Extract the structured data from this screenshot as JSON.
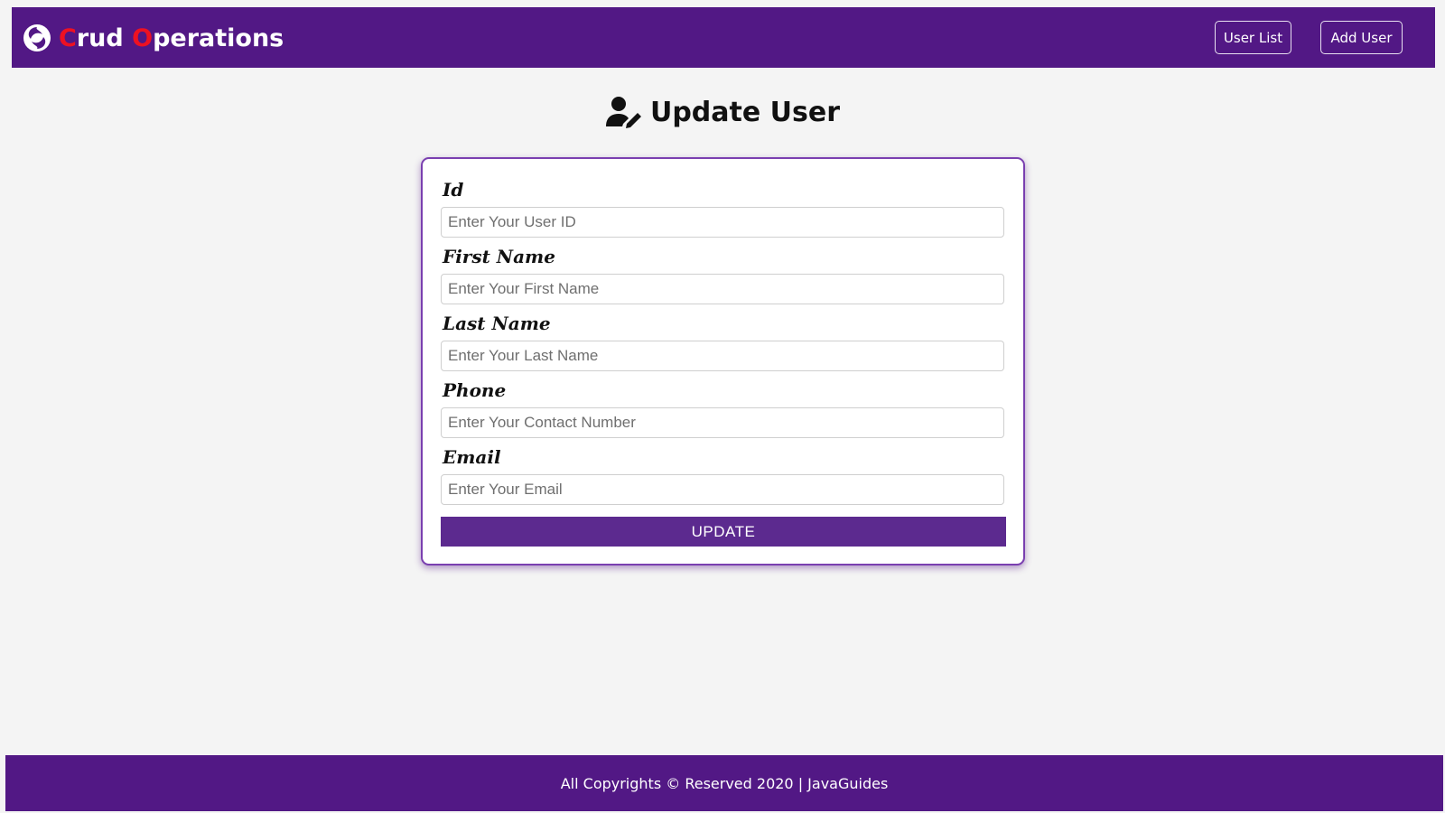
{
  "navbar": {
    "brand_first_letter_1": "C",
    "brand_rest_1": "rud",
    "brand_first_letter_2": "O",
    "brand_rest_2": "perations",
    "logo_icon": "swirl-logo-icon",
    "buttons": [
      {
        "label": "User List"
      },
      {
        "label": "Add User"
      }
    ]
  },
  "page": {
    "title": "Update User",
    "title_icon": "user-edit-icon"
  },
  "form": {
    "fields": [
      {
        "label": "Id",
        "placeholder": "Enter Your User ID",
        "value": ""
      },
      {
        "label": "First Name",
        "placeholder": "Enter Your First Name",
        "value": ""
      },
      {
        "label": "Last Name",
        "placeholder": "Enter Your Last Name",
        "value": ""
      },
      {
        "label": "Phone",
        "placeholder": "Enter Your Contact Number",
        "value": ""
      },
      {
        "label": "Email",
        "placeholder": "Enter Your Email",
        "value": ""
      }
    ],
    "submit_label": "UPDATE"
  },
  "footer": {
    "text": "All Copyrights © Reserved 2020 | JavaGuides"
  },
  "colors": {
    "header_bg": "#521885",
    "brand_accent": "#ee1122",
    "button_bg": "#5c2a8f",
    "page_bg": "#f4f4f4"
  }
}
